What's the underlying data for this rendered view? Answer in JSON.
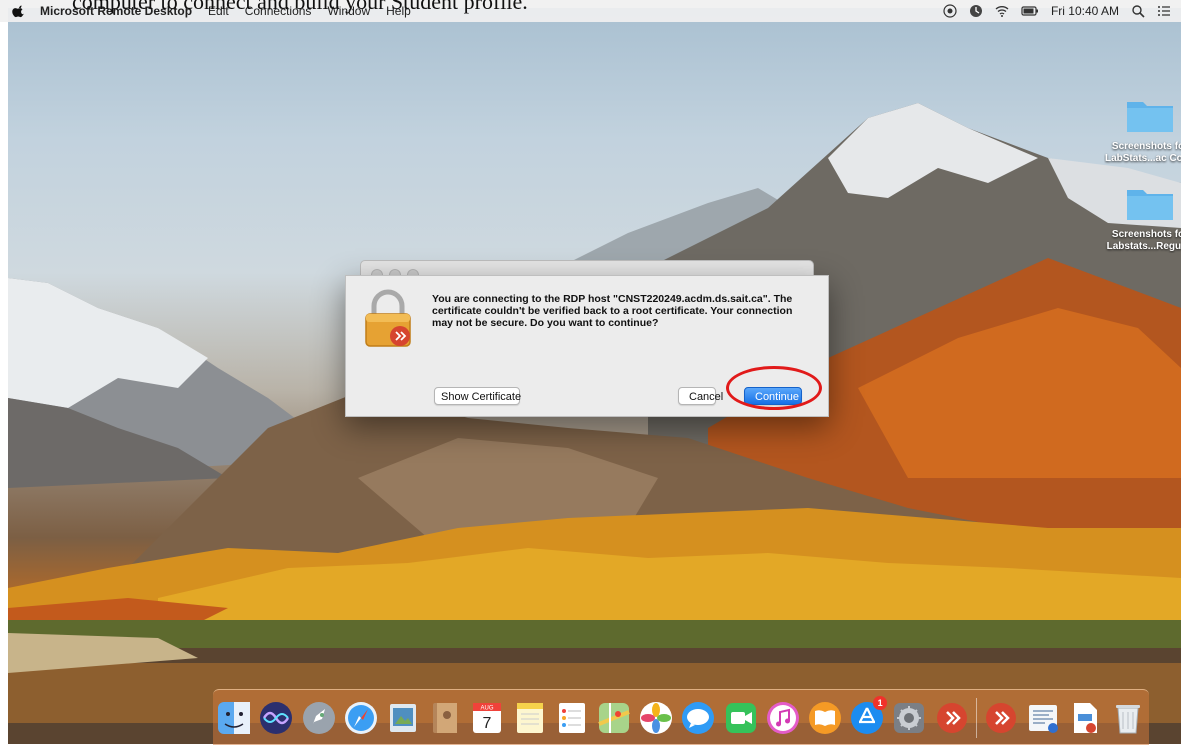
{
  "document": {
    "line": "computer to connect and build your Student profile."
  },
  "menubar": {
    "app": "Microsoft Remote Desktop",
    "items": [
      "Edit",
      "Connections",
      "Window",
      "Help"
    ],
    "clock": "Fri 10:40 AM"
  },
  "desktop": {
    "folders": [
      {
        "label_1": "Screenshots for",
        "label_2": "LabStats...ac Conn"
      },
      {
        "label_1": "Screenshots for",
        "label_2": "Labstats...Regular"
      }
    ]
  },
  "dialog": {
    "message": "You are connecting to the RDP host \"CNST220249.acdm.ds.sait.ca\". The certificate couldn't be verified back to a root certificate. Your connection may not be secure. Do you want to continue?",
    "show_certificate": "Show Certificate",
    "cancel": "Cancel",
    "continue": "Continue"
  },
  "dock": {
    "calendar_month": "AUG",
    "calendar_day": "7",
    "appstore_badge": "1"
  },
  "colors": {
    "accent": "#1670e6",
    "annotation": "#e11a1a"
  }
}
